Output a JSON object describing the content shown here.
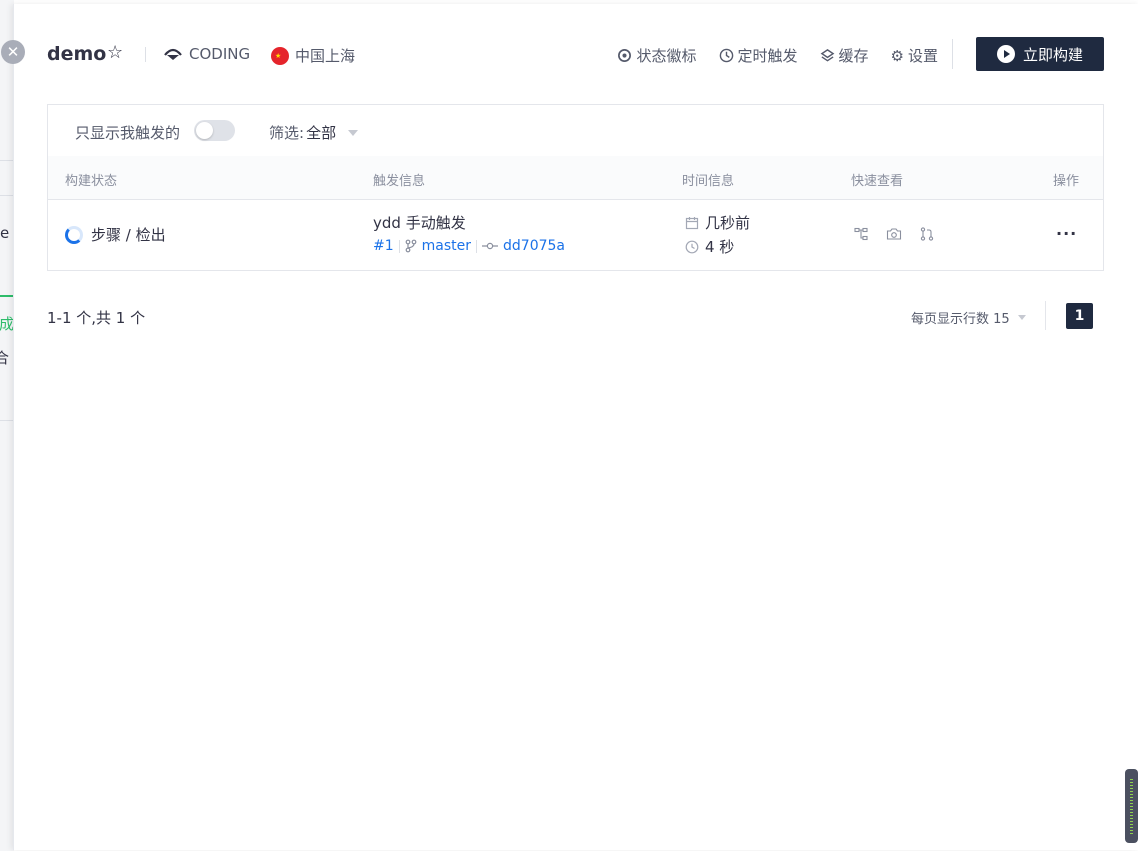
{
  "background": {
    "text_e": "e",
    "text_cheng": "成",
    "text_he": "合"
  },
  "header": {
    "title": "demo",
    "provider": "CODING",
    "region": "中国上海",
    "actions": {
      "status_badge": "状态徽标",
      "scheduled_trigger": "定时触发",
      "cache": "缓存",
      "settings": "设置"
    },
    "build_button": "立即构建"
  },
  "filter": {
    "only_mine_label": "只显示我触发的",
    "only_mine_on": false,
    "filter_label": "筛选:",
    "filter_value": "全部"
  },
  "table": {
    "columns": [
      "构建状态",
      "触发信息",
      "时间信息",
      "快速查看",
      "操作"
    ],
    "rows": [
      {
        "status": "步骤 / 检出",
        "trigger": "ydd 手动触发",
        "build_no": "#1",
        "branch": "master",
        "commit": "dd7075a",
        "time_ago": "几秒前",
        "duration": "4 秒"
      }
    ]
  },
  "pagination": {
    "summary": "1-1 个,共 1 个",
    "page_size_label": "每页显示行数 15",
    "current_page": "1"
  },
  "colors": {
    "primary_dark": "#1f2a40",
    "link_blue": "#1b72e8",
    "success_green": "#2ebd6b"
  }
}
